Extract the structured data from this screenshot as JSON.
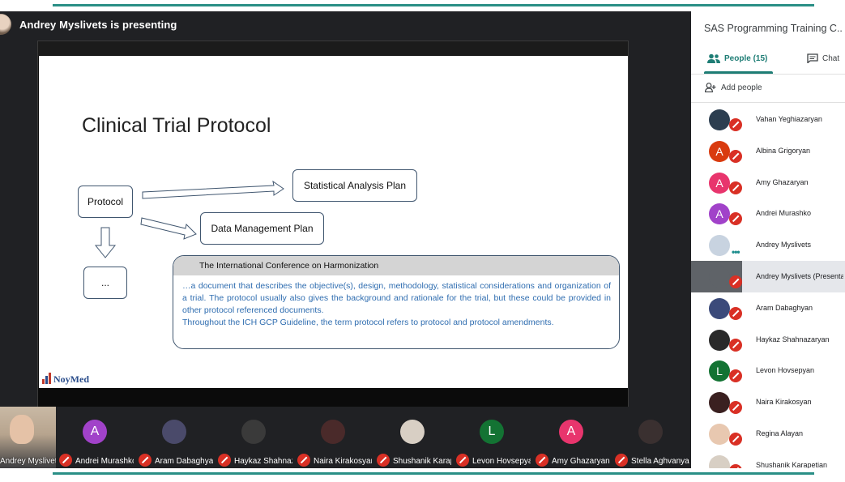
{
  "meeting": {
    "presenter_banner": "Andrey Myslivets is presenting"
  },
  "slide": {
    "title": "Clinical Trial Protocol",
    "boxes": {
      "protocol": "Protocol",
      "sap": "Statistical Analysis Plan",
      "dmp": "Data Management Plan",
      "dots": "..."
    },
    "ich": {
      "heading": "The International Conference on Harmonization",
      "paragraph": "…a document that describes the objective(s), design, methodology, statistical considerations and organization of a trial. The protocol usually also gives the background and rationale for the trial, but these could be provided in other protocol referenced documents.",
      "line2": "Throughout the ICH GCP Guideline, the term protocol refers to protocol and protocol amendments."
    },
    "logo_text": "NoyMed"
  },
  "filmstrip": {
    "self_name": "Andrey Myslivets",
    "tiles": [
      {
        "name": "Andrei Murashko",
        "initial": "A",
        "color": "#a142c9",
        "icon": "avatar-letter"
      },
      {
        "name": "Aram Dabaghyan",
        "initial": "",
        "color": "#4a4a6a",
        "icon": "avatar-photo"
      },
      {
        "name": "Haykaz Shahnazaryan",
        "initial": "",
        "color": "#3a3a3a",
        "icon": "avatar-photo"
      },
      {
        "name": "Naira Kirakosyan",
        "initial": "",
        "color": "#4a2a2a",
        "icon": "avatar-photo"
      },
      {
        "name": "Shushanik Karapetian",
        "initial": "",
        "color": "#d8cfc4",
        "icon": "avatar-photo"
      },
      {
        "name": "Levon Hovsepyan",
        "initial": "L",
        "color": "#137333",
        "icon": "avatar-letter"
      },
      {
        "name": "Amy Ghazaryan",
        "initial": "A",
        "color": "#e8356d",
        "icon": "avatar-letter"
      },
      {
        "name": "Stella Aghvanyan",
        "initial": "",
        "color": "#3a3030",
        "icon": "avatar-photo"
      }
    ]
  },
  "panel": {
    "title": "SAS Programming Training C...",
    "tab_people": "People (15)",
    "tab_chat": "Chat",
    "add_people": "Add people",
    "people": [
      {
        "name": "Vahan Yeghiazaryan",
        "initial": "",
        "color": "#2c3e50",
        "muted": true
      },
      {
        "name": "Albina Grigoryan",
        "initial": "A",
        "color": "#d93b0f",
        "muted": true
      },
      {
        "name": "Amy Ghazaryan",
        "initial": "A",
        "color": "#e8356d",
        "muted": true
      },
      {
        "name": "Andrei Murashko",
        "initial": "A",
        "color": "#a142c9",
        "muted": true
      },
      {
        "name": "Andrey Myslivets",
        "initial": "",
        "color": "#c8d3e0",
        "muted": false
      },
      {
        "name": "Andrey Myslivets (Presentation)",
        "initial": "",
        "color": "#5f6368",
        "muted": true
      },
      {
        "name": "Aram Dabaghyan",
        "initial": "",
        "color": "#3b4a7a",
        "muted": true
      },
      {
        "name": "Haykaz Shahnazaryan",
        "initial": "",
        "color": "#2a2a2a",
        "muted": true
      },
      {
        "name": "Levon Hovsepyan",
        "initial": "L",
        "color": "#137333",
        "muted": true
      },
      {
        "name": "Naira Kirakosyan",
        "initial": "",
        "color": "#3a2020",
        "muted": true
      },
      {
        "name": "Regina Alayan",
        "initial": "",
        "color": "#e8c8b0",
        "muted": true
      },
      {
        "name": "Shushanik Karapetian",
        "initial": "",
        "color": "#d8cfc4",
        "muted": true
      }
    ]
  },
  "colors": {
    "accent": "#1e7d75",
    "mic_off": "#d93025",
    "dark_bg": "#202124"
  }
}
